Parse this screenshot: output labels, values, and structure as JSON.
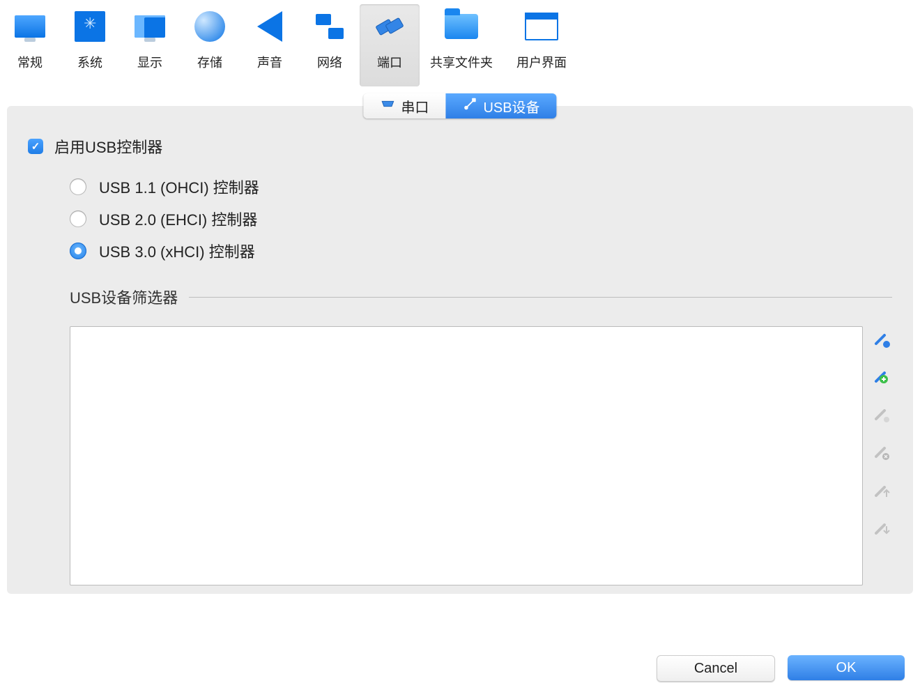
{
  "toolbar": {
    "items": [
      {
        "id": "general",
        "label": "常规"
      },
      {
        "id": "system",
        "label": "系统"
      },
      {
        "id": "display",
        "label": "显示"
      },
      {
        "id": "storage",
        "label": "存储"
      },
      {
        "id": "audio",
        "label": "声音"
      },
      {
        "id": "network",
        "label": "网络"
      },
      {
        "id": "ports",
        "label": "端口",
        "selected": true
      },
      {
        "id": "shared",
        "label": "共享文件夹"
      },
      {
        "id": "ui",
        "label": "用户界面"
      }
    ]
  },
  "tabs": {
    "serial": "串口",
    "usb": "USB设备",
    "active": "usb"
  },
  "usb": {
    "enable_label": "启用USB控制器",
    "enabled": true,
    "controllers": [
      {
        "id": "ohci",
        "label": "USB 1.1 (OHCI) 控制器",
        "selected": false
      },
      {
        "id": "ehci",
        "label": "USB 2.0 (EHCI) 控制器",
        "selected": false
      },
      {
        "id": "xhci",
        "label": "USB 3.0 (xHCI) 控制器",
        "selected": true
      }
    ],
    "filters_title": "USB设备筛选器",
    "filter_buttons": [
      {
        "id": "add-empty",
        "enabled": true
      },
      {
        "id": "add-device",
        "enabled": true
      },
      {
        "id": "edit",
        "enabled": false
      },
      {
        "id": "remove",
        "enabled": false
      },
      {
        "id": "move-up",
        "enabled": false
      },
      {
        "id": "move-down",
        "enabled": false
      }
    ]
  },
  "footer": {
    "cancel": "Cancel",
    "ok": "OK"
  }
}
